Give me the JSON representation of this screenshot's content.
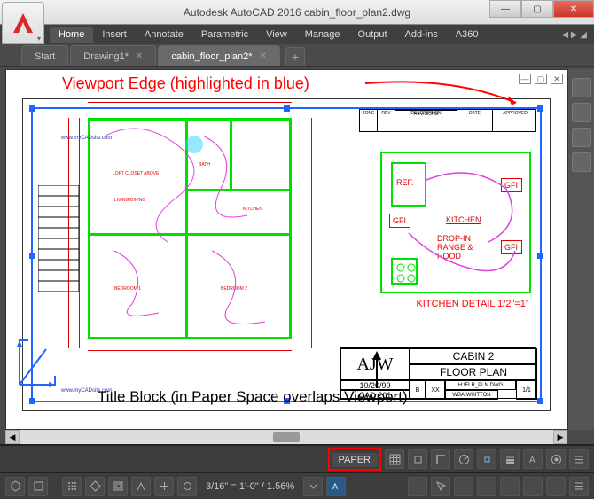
{
  "window": {
    "title": "Autodesk AutoCAD 2016     cabin_floor_plan2.dwg"
  },
  "ribbon": {
    "tabs": [
      "Home",
      "Insert",
      "Annotate",
      "Parametric",
      "View",
      "Manage",
      "Output",
      "Add-ins",
      "A360"
    ]
  },
  "filetabs": {
    "items": [
      {
        "label": "Start"
      },
      {
        "label": "Drawing1*"
      },
      {
        "label": "cabin_floor_plan2*"
      }
    ]
  },
  "annotations": {
    "viewport_edge": "Viewport Edge (highlighted in blue)",
    "title_block": "Title Block (in Paper Space overlaps Viewport)"
  },
  "kitchen_detail": {
    "ref": "REF.",
    "gfi": "GFI",
    "kitchen": "KITCHEN",
    "dropin": "DROP-IN RANGE & HOOD",
    "caption": "KITCHEN DETAIL 1/2\"=1'"
  },
  "titleblock": {
    "initials": "AJW",
    "project": "CABIN 2",
    "sheet": "FLOOR PLAN",
    "date": "10/20/99",
    "cad": "CAD 201",
    "drawn": "WBA.WHITTON",
    "file": "H:\\FLR_PLN.DWG",
    "scale": "1/1",
    "rev": "B",
    "xx": "XX"
  },
  "revblock": {
    "cols": [
      "ZONE",
      "REV",
      "DESCRIPTION",
      "REVISIONS",
      "DATE",
      "APPROVED"
    ]
  },
  "floorplan": {
    "rooms": [
      "LIVING/DINING",
      "BATH",
      "KITCHEN",
      "BEDROOM 1",
      "BEDROOM 2"
    ],
    "closet": "LOFT CLOSET ABOVE"
  },
  "status": {
    "paper_label": "PAPER",
    "scale_text": "3/16\" = 1'-0\" / 1.56%"
  },
  "watermark": "www.myCADsite.com",
  "drawing_controls": {
    "min": "—",
    "max": "▢",
    "close": "✕"
  }
}
